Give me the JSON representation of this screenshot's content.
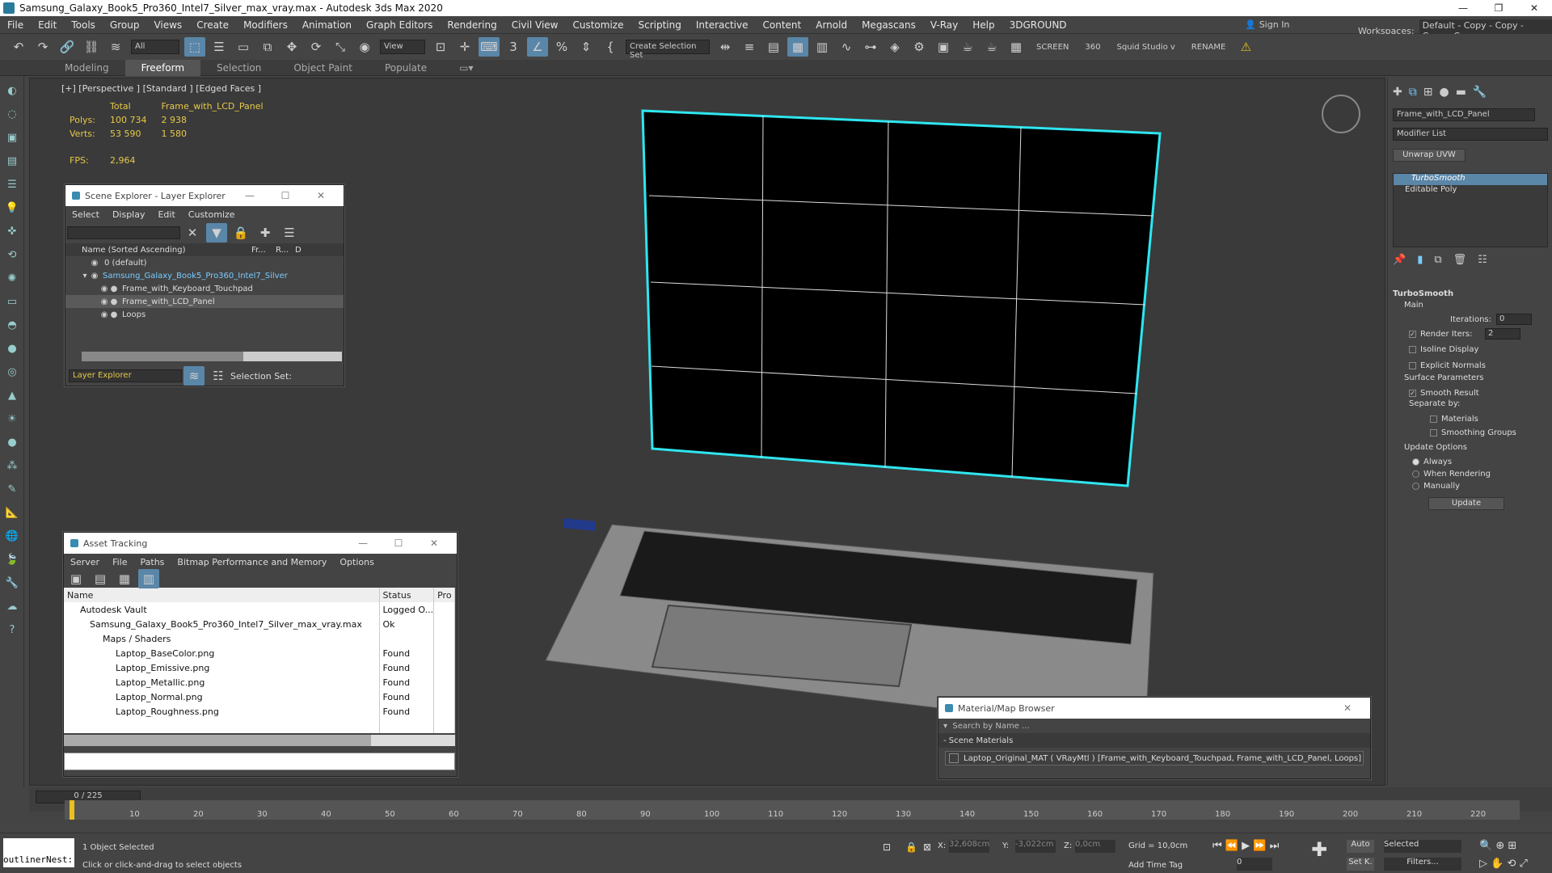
{
  "window": {
    "title": "Samsung_Galaxy_Book5_Pro360_Intel7_Silver_max_vray.max - Autodesk 3ds Max 2020",
    "controls": [
      "—",
      "❐",
      "✕"
    ]
  },
  "menubar": {
    "items": [
      "File",
      "Edit",
      "Tools",
      "Group",
      "Views",
      "Create",
      "Modifiers",
      "Animation",
      "Graph Editors",
      "Rendering",
      "Civil View",
      "Customize",
      "Scripting",
      "Interactive",
      "Content",
      "Arnold",
      "Megascans",
      "V-Ray",
      "Help",
      "3DGROUND"
    ],
    "sign_in": "Sign In",
    "workspaces_label": "Workspaces:",
    "workspaces_value": "Default - Copy - Copy - Copy - Copy"
  },
  "toolbar": {
    "filter": "All",
    "view": "View",
    "selection_set": "Create Selection Set",
    "screen": "SCREEN",
    "num360": "360",
    "squid": "Squid Studio v",
    "rename": "RENAME"
  },
  "ribbon": {
    "tabs": [
      "Modeling",
      "Freeform",
      "Selection",
      "Object Paint",
      "Populate"
    ]
  },
  "viewport": {
    "label": "[+] [Perspective ] [Standard ] [Edged Faces ]",
    "stats": {
      "h_total": "Total",
      "h_obj": "Frame_with_LCD_Panel",
      "polys_label": "Polys:",
      "polys_total": "100 734",
      "polys_obj": "2 938",
      "verts_label": "Verts:",
      "verts_total": "53 590",
      "verts_obj": "1 580",
      "fps_label": "FPS:",
      "fps": "2,964"
    }
  },
  "scene_explorer": {
    "title": "Scene Explorer - Layer Explorer",
    "menu": [
      "Select",
      "Display",
      "Edit",
      "Customize"
    ],
    "col_name": "Name (Sorted Ascending)",
    "col_fr": "Fr...",
    "col_r": "R...",
    "col_d": "D",
    "rows": [
      "0 (default)",
      "Samsung_Galaxy_Book5_Pro360_Intel7_Silver",
      "Frame_with_Keyboard_Touchpad",
      "Frame_with_LCD_Panel",
      "Loops"
    ],
    "footer_explorer": "Layer Explorer",
    "footer_sel": "Selection Set:"
  },
  "asset_tracking": {
    "title": "Asset Tracking",
    "menu": [
      "Server",
      "File",
      "Paths",
      "Bitmap Performance and Memory",
      "Options"
    ],
    "col_name": "Name",
    "col_status": "Status",
    "col_pro": "Pro",
    "rows": [
      {
        "name": "Autodesk Vault",
        "status": "Logged O..."
      },
      {
        "name": "Samsung_Galaxy_Book5_Pro360_Intel7_Silver_max_vray.max",
        "status": "Ok"
      },
      {
        "name": "Maps / Shaders",
        "status": ""
      },
      {
        "name": "Laptop_BaseColor.png",
        "status": "Found"
      },
      {
        "name": "Laptop_Emissive.png",
        "status": "Found"
      },
      {
        "name": "Laptop_Metallic.png",
        "status": "Found"
      },
      {
        "name": "Laptop_Normal.png",
        "status": "Found"
      },
      {
        "name": "Laptop_Roughness.png",
        "status": "Found"
      }
    ]
  },
  "material_browser": {
    "title": "Material/Map Browser",
    "search_placeholder": "Search by Name ...",
    "section": "- Scene Materials",
    "material": "Laptop_Original_MAT  ( VRayMtl )  [Frame_with_Keyboard_Touchpad, Frame_with_LCD_Panel, Loops]"
  },
  "command_panel": {
    "object_name": "Frame_with_LCD_Panel",
    "modifier_list": "Modifier List",
    "unwrap": "Unwrap UVW",
    "stack": [
      "TurboSmooth",
      "Editable Poly"
    ],
    "ts": {
      "title": "TurboSmooth",
      "main": "Main",
      "iterations_label": "Iterations:",
      "iterations": "0",
      "render_iters_label": "Render Iters:",
      "render_iters": "2",
      "isoline": "Isoline Display",
      "explicit": "Explicit Normals",
      "surface": "Surface Parameters",
      "smooth_result": "Smooth Result",
      "separate": "Separate by:",
      "materials": "Materials",
      "smoothing": "Smoothing Groups",
      "update_options": "Update Options",
      "always": "Always",
      "when_rendering": "When Rendering",
      "manually": "Manually",
      "update_btn": "Update"
    }
  },
  "timeline": {
    "frame": "0 / 225",
    "ticks": [
      "10",
      "20",
      "30",
      "40",
      "50",
      "60",
      "70",
      "80",
      "90",
      "100",
      "110",
      "120",
      "130",
      "140",
      "150",
      "160",
      "170",
      "180",
      "190",
      "200",
      "210",
      "220"
    ]
  },
  "status": {
    "outliner": "outlinerNest:",
    "selected": "1 Object Selected",
    "hint": "Click or click-and-drag to select objects",
    "x_label": "X:",
    "x": "32,608cm",
    "y_label": "Y:",
    "y": "-3,022cm",
    "z_label": "Z:",
    "z": "0,0cm",
    "grid": "Grid = 10,0cm",
    "add_time_tag": "Add Time Tag",
    "auto": "Auto",
    "set_k": "Set K.",
    "selected_dd": "Selected",
    "filters": "Filters...",
    "frame_field": "0"
  }
}
